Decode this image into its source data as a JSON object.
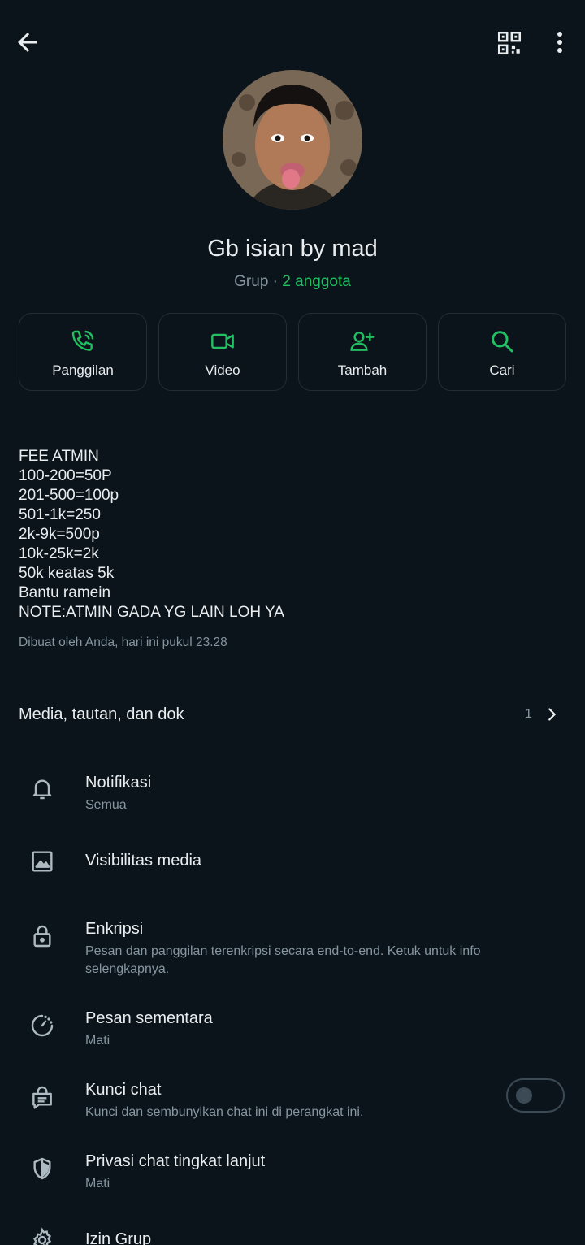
{
  "colors": {
    "background": "#0b141a",
    "accent": "#21c063",
    "muted": "#8696a0",
    "text": "#e9edef"
  },
  "topbar": {
    "back_icon": "arrow-left-icon",
    "qr_icon": "qr-code-icon",
    "menu_icon": "more-vert-icon"
  },
  "group": {
    "name": "Gb isian by mad",
    "type": "Grup",
    "separator": " · ",
    "members": "2 anggota"
  },
  "actions": [
    {
      "label": "Panggilan",
      "icon": "phone-icon"
    },
    {
      "label": "Video",
      "icon": "video-icon"
    },
    {
      "label": "Tambah",
      "icon": "add-person-icon"
    },
    {
      "label": "Cari",
      "icon": "search-icon"
    }
  ],
  "description": {
    "text": "FEE ATMIN\n100-200=50P\n201-500=100p\n501-1k=250\n2k-9k=500p\n10k-25k=2k\n50k keatas 5k\nBantu ramein\nNOTE:ATMIN GADA YG LAIN LOH YA",
    "created": "Dibuat oleh Anda, hari ini pukul 23.28"
  },
  "media": {
    "label": "Media, tautan, dan dok",
    "count": "1"
  },
  "settings": [
    {
      "title": "Notifikasi",
      "subtitle": "Semua",
      "icon": "bell-icon"
    },
    {
      "title": "Visibilitas media",
      "subtitle": "",
      "icon": "image-icon"
    },
    {
      "title": "Enkripsi",
      "subtitle": "Pesan dan panggilan terenkripsi secara end-to-end. Ketuk untuk info selengkapnya.",
      "icon": "lock-icon"
    },
    {
      "title": "Pesan sementara",
      "subtitle": "Mati",
      "icon": "timer-icon"
    },
    {
      "title": "Kunci chat",
      "subtitle": "Kunci dan sembunyikan chat ini di perangkat ini.",
      "icon": "chat-lock-icon",
      "toggle": "off"
    },
    {
      "title": "Privasi chat tingkat lanjut",
      "subtitle": "Mati",
      "icon": "shield-icon"
    },
    {
      "title": "Izin Grup",
      "subtitle": "",
      "icon": "gear-icon"
    }
  ]
}
